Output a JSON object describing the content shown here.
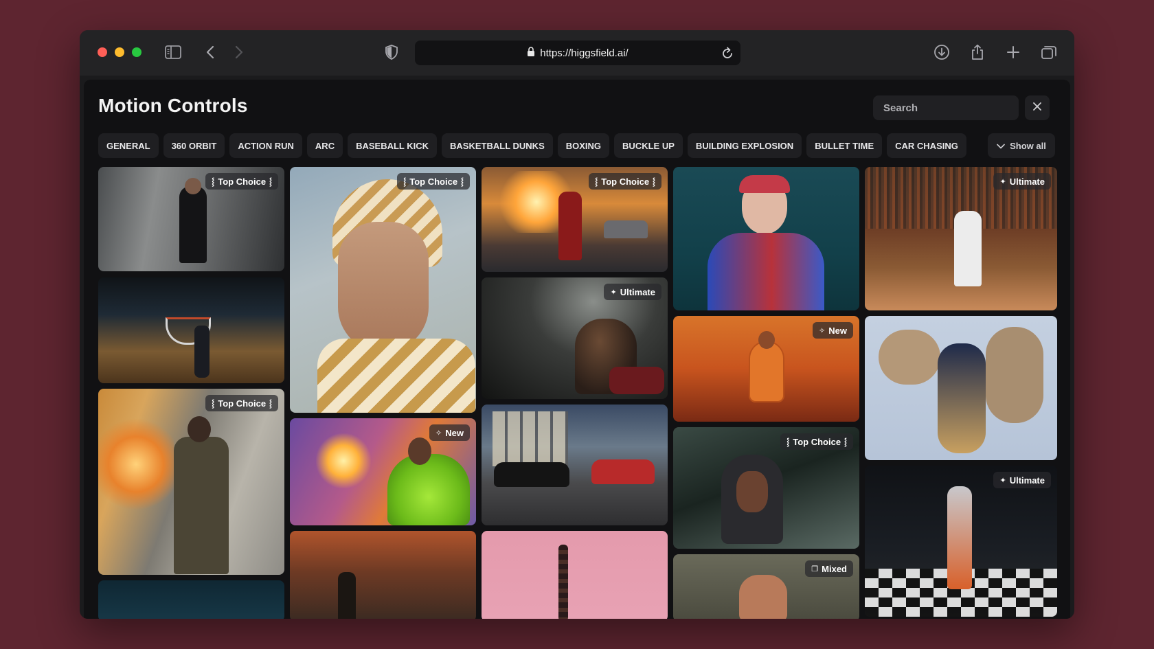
{
  "browser": {
    "url": "https://higgsfield.ai/",
    "icons": [
      "sidebar-icon",
      "back-icon",
      "forward-icon",
      "shield-icon",
      "lock-icon",
      "reload-icon",
      "download-icon",
      "share-icon",
      "new-tab-icon",
      "tabs-overview-icon"
    ]
  },
  "page": {
    "title": "Motion Controls",
    "search_placeholder": "Search"
  },
  "categories": [
    "GENERAL",
    "360 ORBIT",
    "ACTION RUN",
    "ARC",
    "BASEBALL KICK",
    "BASKETBALL DUNKS",
    "BOXING",
    "BUCKLE UP",
    "BUILDING EXPLOSION",
    "BULLET TIME",
    "CAR CHASING"
  ],
  "show_all_label": "Show all",
  "badges": {
    "top_choice": "Top Choice",
    "ultimate": "Ultimate",
    "new": "New",
    "mixed": "Mixed"
  },
  "colors": {
    "page_background": "#5e2530",
    "window_background": "#1b1b1d",
    "content_background": "#111113",
    "chip_background": "#1f1f22"
  }
}
